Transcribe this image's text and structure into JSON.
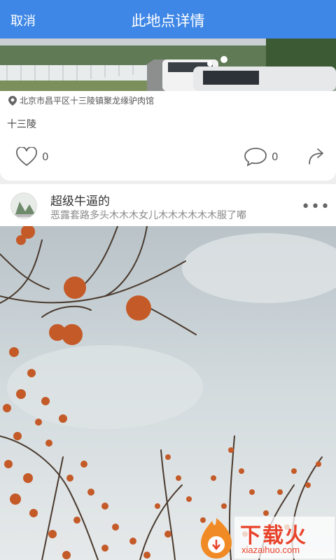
{
  "header": {
    "cancel_label": "取消",
    "title": "此地点详情"
  },
  "location_card": {
    "address": "北京市昌平区十三陵镇聚龙缘驴肉馆",
    "place_name": "十三陵",
    "like_count": "0",
    "comment_count": "0"
  },
  "post": {
    "username": "超级牛逼的",
    "description": "恶露套路多头木木木女儿木木木木木木服了嘟",
    "more_label": "•••"
  },
  "watermark": {
    "brand": "下载火",
    "domain": "xiazaihuo.com"
  },
  "colors": {
    "header": "#3f87e6",
    "accent": "#e8432a"
  }
}
